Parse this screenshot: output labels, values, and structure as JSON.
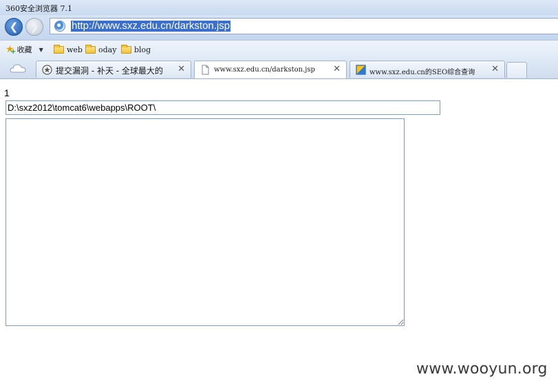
{
  "window": {
    "title": "360安全浏览器 7.1"
  },
  "navigation": {
    "back_icon": "back-arrow-icon",
    "forward_icon": "forward-arrow-icon",
    "address": "http://www.sxz.edu.cn/darkston.jsp"
  },
  "favorites": {
    "label": "收藏",
    "folders": [
      "web",
      "oday",
      "blog"
    ]
  },
  "tabs": [
    {
      "label": "提交漏洞 - 补天 - 全球最大的",
      "icon": "butian-icon",
      "active": false
    },
    {
      "label": "www.sxz.edu.cn/darkston.jsp",
      "icon": "page-icon",
      "active": true
    },
    {
      "label": "www.sxz.edu.cn的SEO综合查询",
      "icon": "seo-icon",
      "active": false
    }
  ],
  "page": {
    "counter": "1",
    "path_value": "D:\\sxz2012\\tomcat6\\webapps\\ROOT\\",
    "textarea_value": ""
  },
  "watermark": "www.wooyun.org"
}
